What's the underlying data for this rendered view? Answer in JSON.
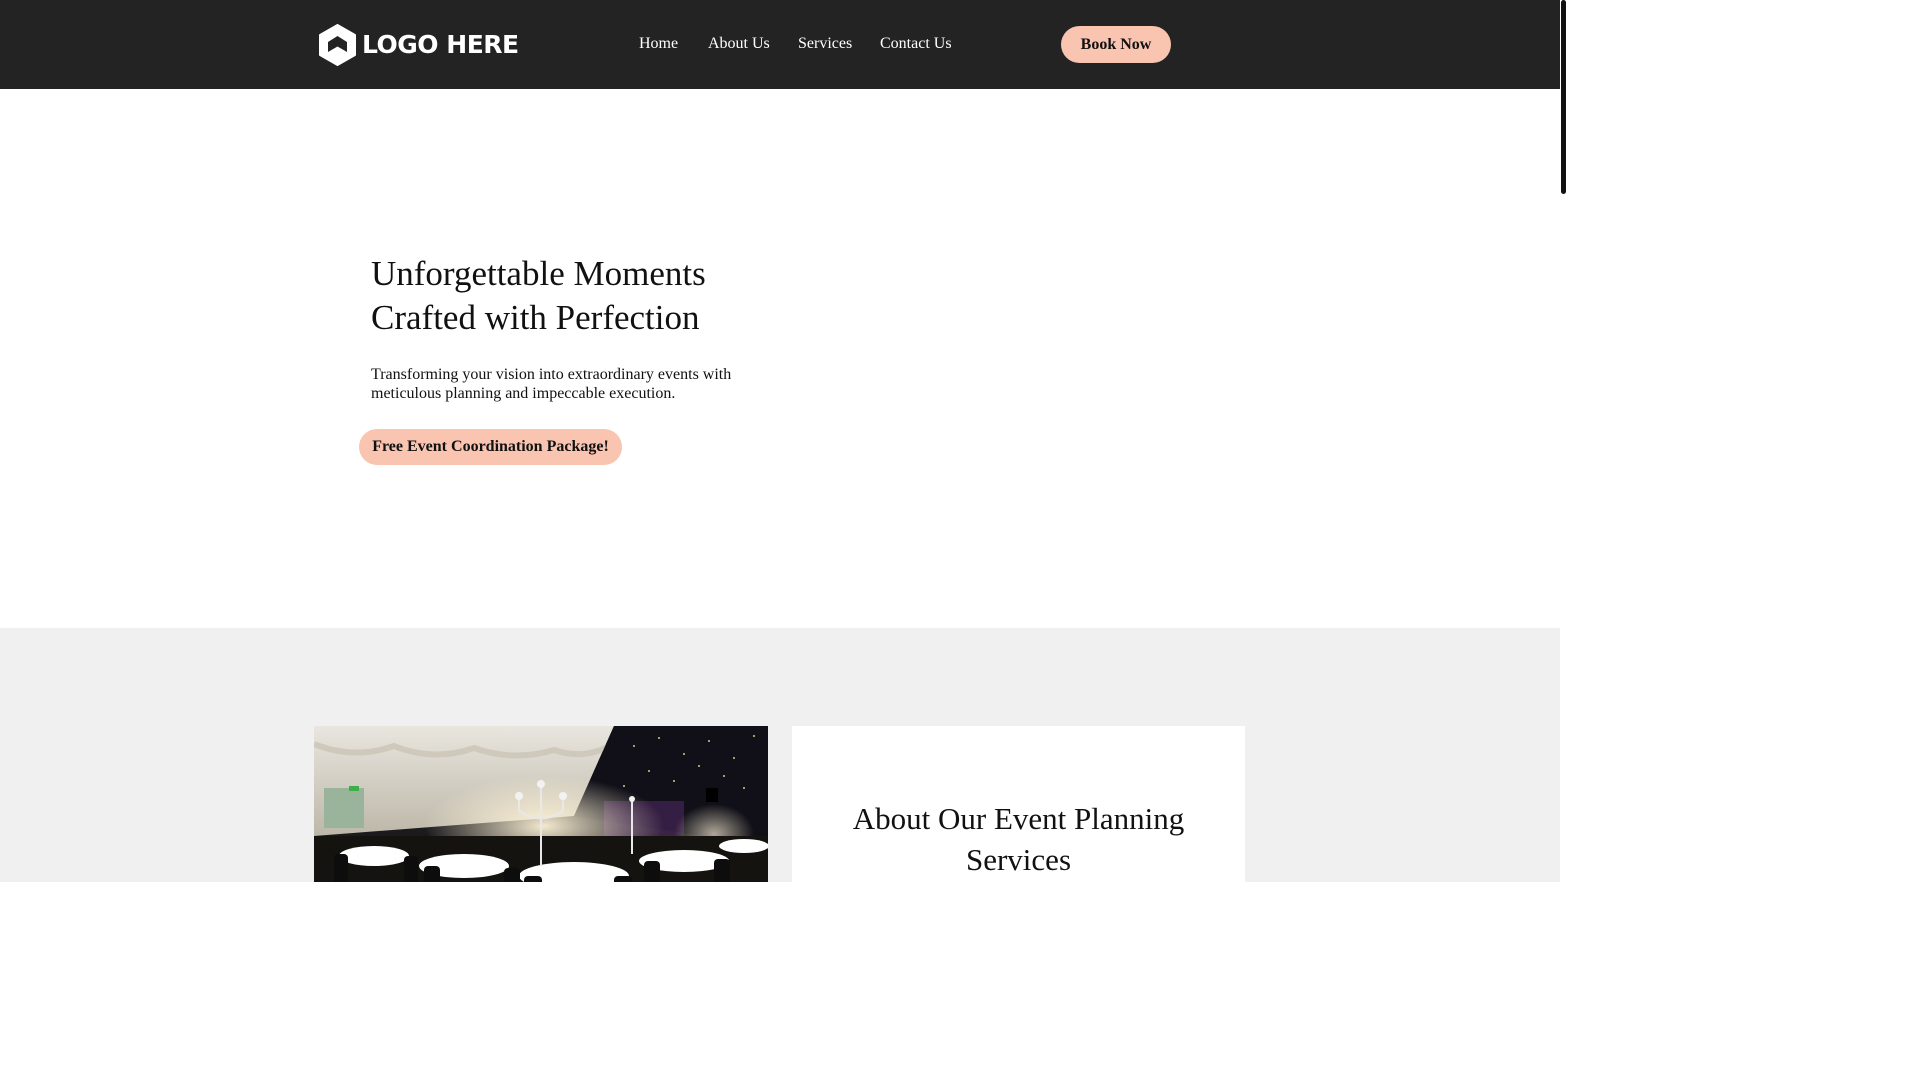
{
  "header": {
    "logo_text": "LOGO HERE",
    "nav": [
      {
        "label": "Home"
      },
      {
        "label": "About Us"
      },
      {
        "label": "Services"
      },
      {
        "label": "Contact Us"
      }
    ],
    "book_label": "Book Now"
  },
  "hero": {
    "title_line1": "Unforgettable Moments",
    "title_line2": "Crafted with Perfection",
    "subtitle_line1": "Transforming your vision into extraordinary events with",
    "subtitle_line2": "meticulous planning and impeccable execution.",
    "cta_label": "Free Event Coordination Package!"
  },
  "about": {
    "title_line1": "About Our Event Planning",
    "title_line2": "Services"
  },
  "colors": {
    "header_bg": "#232323",
    "accent_button": "#f9c4b0",
    "section_bg": "#f0f0f0"
  },
  "icons": {
    "logo": "hexagon-logo-icon"
  }
}
